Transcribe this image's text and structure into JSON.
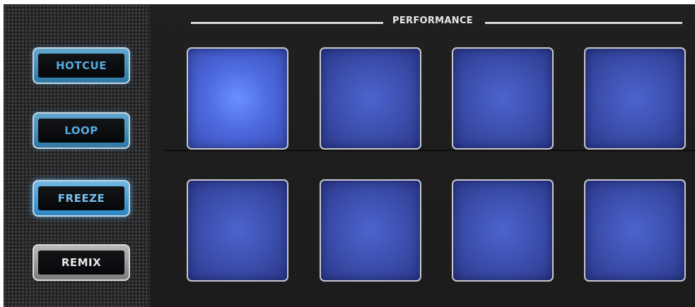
{
  "section": {
    "title": "PERFORMANCE"
  },
  "mode_buttons": [
    {
      "label": "HOTCUE",
      "state": "lit"
    },
    {
      "label": "LOOP",
      "state": "lit"
    },
    {
      "label": "FREEZE",
      "state": "lit-strong"
    },
    {
      "label": "REMIX",
      "state": "unlit"
    }
  ],
  "pads": {
    "rows": 2,
    "columns": 4,
    "count": 8,
    "active_pad": 1
  },
  "colors": {
    "pad_blue": "#3b4daa",
    "pad_active": "#6b90ff",
    "mode_lit": "#3d8fc4",
    "mode_unlit": "#8f8f8f",
    "panel": "#1c1c1d"
  }
}
